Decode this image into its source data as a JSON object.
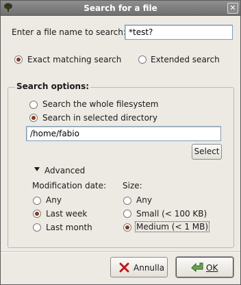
{
  "window": {
    "title": "Search for a file"
  },
  "filename": {
    "label": "Enter a file name to search:",
    "value": "*test?"
  },
  "mode": {
    "exact_label": "Exact matching search",
    "exact_selected": true,
    "extended_label": "Extended search",
    "extended_selected": false
  },
  "options": {
    "section_label": "Search options:",
    "whole_fs_label": "Search the whole filesystem",
    "selected_dir_label": "Search in selected directory",
    "directory_value": "/home/fabio",
    "select_button": "Select",
    "advanced_label": "Advanced",
    "modification": {
      "header": "Modification date:",
      "items": [
        "Any",
        "Last week",
        "Last month"
      ],
      "selected": "Last week"
    },
    "size": {
      "header": "Size:",
      "items": [
        "Any",
        "Small (< 100 KB)",
        "Medium (< 1 MB)"
      ],
      "selected": "Medium (< 1 MB)"
    }
  },
  "buttons": {
    "cancel": "Annulla",
    "ok": "OK"
  },
  "icons": {
    "app": "tree-icon",
    "close": "close-icon",
    "expander": "triangle-down-icon",
    "cancel": "x-icon",
    "ok": "checkmark-arrow-icon"
  },
  "colors": {
    "titlebar": "#7f7f7f",
    "radio_dot": "#8a3a1a",
    "cancel_x": "#c01818",
    "ok_arrow": "#3d7a2a"
  }
}
